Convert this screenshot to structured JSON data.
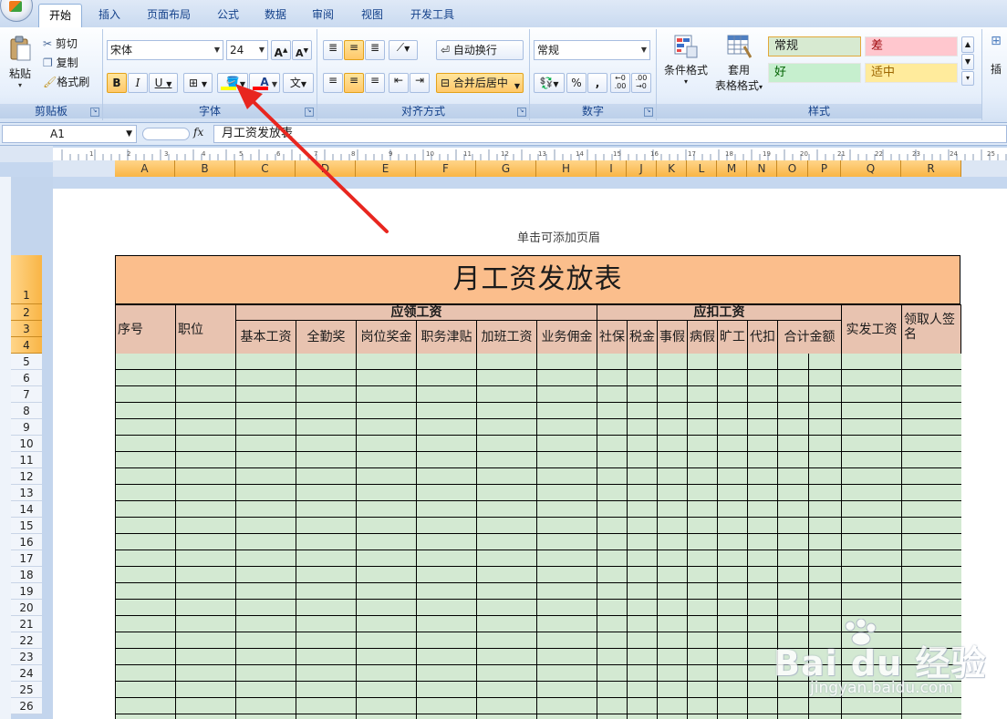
{
  "tabs": [
    "开始",
    "插入",
    "页面布局",
    "公式",
    "数据",
    "审阅",
    "视图",
    "开发工具"
  ],
  "clipboard": {
    "paste": "粘贴",
    "cut": "剪切",
    "copy": "复制",
    "format_painter": "格式刷",
    "label": "剪贴板"
  },
  "font": {
    "name": "宋体",
    "size": "24",
    "bold": "B",
    "italic": "I",
    "underline": "U",
    "label": "字体",
    "fill_color": "#ffff00",
    "font_color": "#ff0000",
    "phonetic": "文"
  },
  "alignment": {
    "wrap": "自动换行",
    "merge": "合并后居中",
    "label": "对齐方式"
  },
  "number": {
    "format": "常规",
    "percent": "%",
    "comma": ",",
    "label": "数字"
  },
  "styles": {
    "cond_format": "条件格式",
    "table_format_1": "套用",
    "table_format_2": "表格格式",
    "label": "样式",
    "cells": [
      "常规",
      "差",
      "好",
      "适中"
    ]
  },
  "insert_partial": "插",
  "name_box": "A1",
  "fx": "fx",
  "formula": "月工资发放表",
  "columns": [
    "A",
    "B",
    "C",
    "D",
    "E",
    "F",
    "G",
    "H",
    "I",
    "J",
    "K",
    "L",
    "M",
    "N",
    "O",
    "P",
    "Q",
    "R"
  ],
  "rows": [
    "1",
    "2",
    "3",
    "4",
    "5",
    "6",
    "7",
    "8",
    "9",
    "10",
    "11",
    "12",
    "13",
    "14",
    "15",
    "16",
    "17",
    "18",
    "19",
    "20",
    "21",
    "22",
    "23",
    "24",
    "25",
    "26"
  ],
  "header_hint": "单击可添加页眉",
  "sheet": {
    "title": "月工资发放表",
    "seq": "序号",
    "position": "职位",
    "group_due": "应领工资",
    "group_deduct": "应扣工资",
    "due_items": [
      "基本工资",
      "全勤奖",
      "岗位奖金",
      "职务津贴",
      "加班工资",
      "业务佣金"
    ],
    "deduct_items": [
      "社保",
      "税金",
      "事假",
      "病假",
      "旷工",
      "代扣",
      "合计金额"
    ],
    "actual": "实发工资",
    "sign": "领取人签名"
  },
  "ruler_numbers": [
    "1",
    "2",
    "3",
    "4",
    "5",
    "6",
    "7",
    "8",
    "9",
    "10",
    "11",
    "12",
    "13",
    "14",
    "15",
    "16",
    "17",
    "18",
    "19",
    "20",
    "21",
    "22",
    "23",
    "24",
    "25"
  ],
  "watermark": {
    "main": "Bai du 经验",
    "sub": "jingyan.baidu.com"
  }
}
